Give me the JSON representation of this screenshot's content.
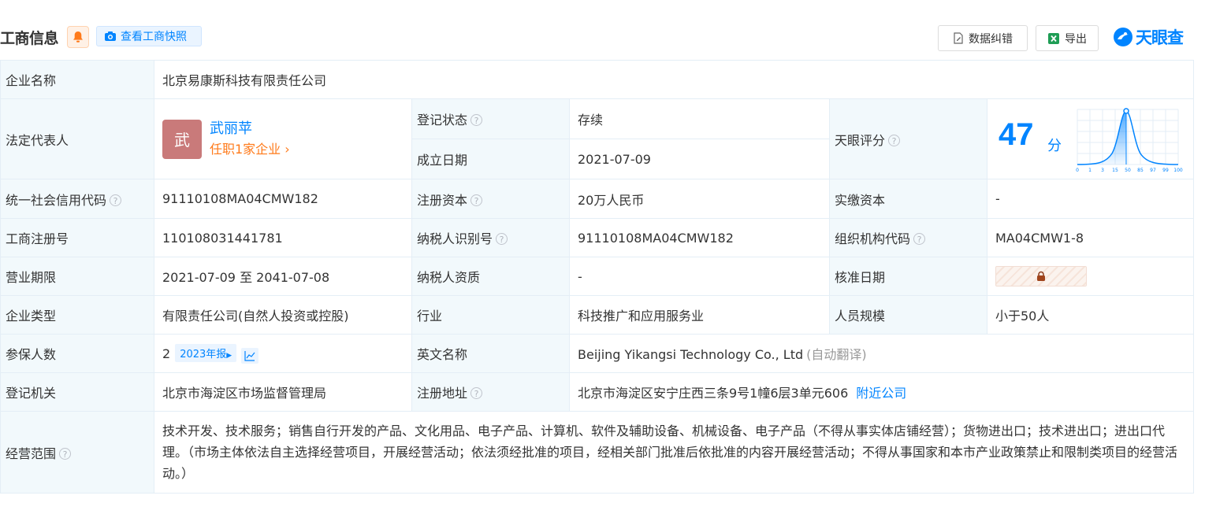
{
  "header": {
    "title": "工商信息",
    "snapshot_label": "查看工商快照",
    "correct_label": "数据纠错",
    "export_label": "导出",
    "logo_text": "天眼查"
  },
  "colors": {
    "accent": "#0084ff",
    "status_green": "#00a35b",
    "orange": "#ff7a1a",
    "label_bg": "#f2f9fc"
  },
  "labels": {
    "company_name": "企业名称",
    "legal_rep": "法定代表人",
    "reg_status": "登记状态",
    "established": "成立日期",
    "tianyan_score": "天眼评分",
    "credit_code": "统一社会信用代码",
    "reg_capital": "注册资本",
    "paid_capital": "实缴资本",
    "biz_reg_no": "工商注册号",
    "taxpayer_id": "纳税人识别号",
    "org_code": "组织机构代码",
    "biz_term": "营业期限",
    "taxpayer_qual": "纳税人资质",
    "approval_date": "核准日期",
    "company_type": "企业类型",
    "industry": "行业",
    "staff_size": "人员规模",
    "insured": "参保人数",
    "english_name": "英文名称",
    "reg_authority": "登记机关",
    "reg_address": "注册地址",
    "biz_scope": "经营范围"
  },
  "values": {
    "company_name": "北京易康斯科技有限责任公司",
    "rep_avatar": "武",
    "rep_name": "武丽苹",
    "rep_positions": "任职1家企业",
    "reg_status": "存续",
    "established": "2021-07-09",
    "score": "47",
    "score_unit": "分",
    "score_ticks": [
      "0",
      "1",
      "3",
      "15",
      "50",
      "85",
      "97",
      "99",
      "100"
    ],
    "credit_code": "91110108MA04CMW182",
    "reg_capital": "20万人民币",
    "paid_capital": "-",
    "biz_reg_no": "110108031441781",
    "taxpayer_id": "91110108MA04CMW182",
    "org_code": "MA04CMW1-8",
    "biz_term": "2021-07-09 至 2041-07-08",
    "taxpayer_qual": "-",
    "company_type": "有限责任公司(自然人投资或控股)",
    "industry": "科技推广和应用服务业",
    "staff_size": "小于50人",
    "insured": "2",
    "insured_year": "2023年报",
    "english_name": "Beijing Yikangsi Technology Co., Ltd",
    "english_note": "(自动翻译)",
    "reg_authority": "北京市海淀区市场监督管理局",
    "reg_address": "北京市海淀区安宁庄西三条9号1幢6层3单元606",
    "nearby": "附近公司",
    "biz_scope": "技术开发、技术服务；销售自行开发的产品、文化用品、电子产品、计算机、软件及辅助设备、机械设备、电子产品（不得从事实体店铺经营）；货物进出口；技术进出口；进出口代理。（市场主体依法自主选择经营项目，开展经营活动；依法须经批准的项目，经相关部门批准后依批准的内容开展经营活动；不得从事国家和本市产业政策禁止和限制类项目的经营活动。）"
  }
}
